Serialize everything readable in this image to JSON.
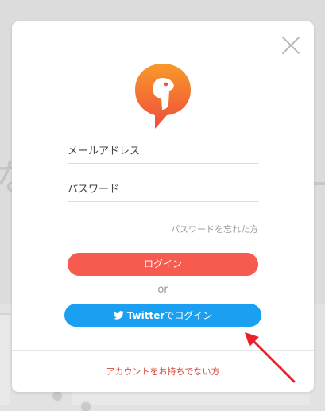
{
  "background": {
    "partial_glyph": "な"
  },
  "modal": {
    "email_placeholder": "メールアドレス",
    "password_placeholder": "パスワード",
    "forgot_password": "パスワードを忘れた方",
    "login_button": "ログイン",
    "or_separator": "or",
    "twitter_button": {
      "brand": "Twitter",
      "suffix": "でログイン",
      "icon": "twitter-bird-icon"
    },
    "signup_link": "アカウントをお持ちでない方",
    "close_icon": "close-icon",
    "logo_icon": "speech-bubble-dog-logo"
  },
  "colors": {
    "login_button": "#f75a4e",
    "twitter_button": "#1b9ff0",
    "signup_link": "#d34b3b",
    "arrow": "#e8202a",
    "logo_gradient_top": "#f89a2a",
    "logo_gradient_bottom": "#ef4b3c"
  }
}
